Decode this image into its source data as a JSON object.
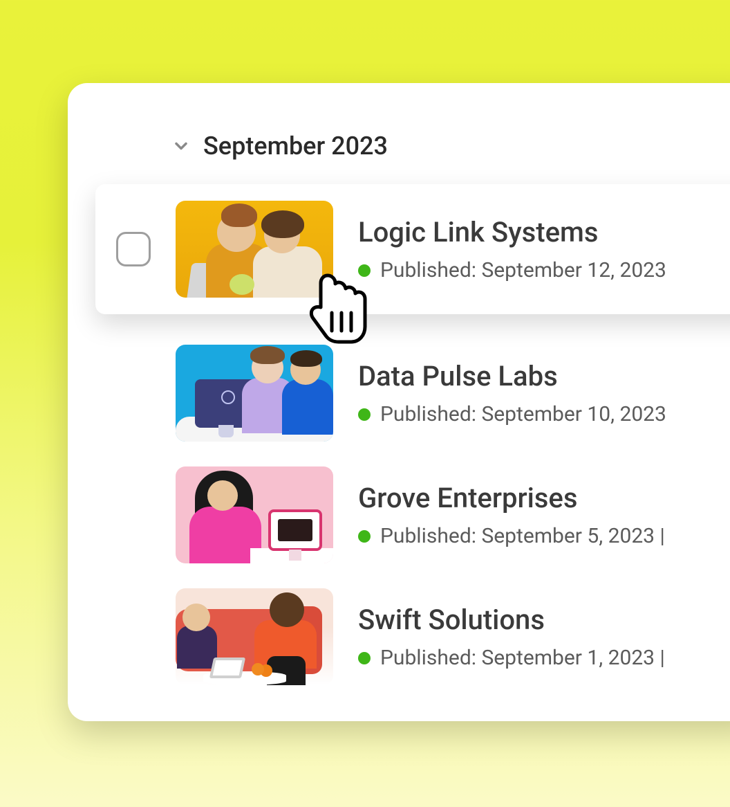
{
  "group": {
    "title": "September 2023"
  },
  "status_color": "#3fb618",
  "items": [
    {
      "title": "Logic Link Systems",
      "status_label": "Published: September 12, 2023",
      "thumbnail": "yellow-two-people-laptop",
      "selected": false,
      "hovered": true
    },
    {
      "title": "Data Pulse Labs",
      "status_label": "Published: September 10, 2023",
      "thumbnail": "blue-two-people-imac",
      "selected": false,
      "hovered": false
    },
    {
      "title": "Grove Enterprises",
      "status_label": "Published: September 5, 2023 |",
      "thumbnail": "pink-woman-imac",
      "selected": false,
      "hovered": false
    },
    {
      "title": "Swift Solutions",
      "status_label": "Published: September 1, 2023 |",
      "thumbnail": "red-sofa-two-people",
      "selected": false,
      "hovered": false
    }
  ]
}
